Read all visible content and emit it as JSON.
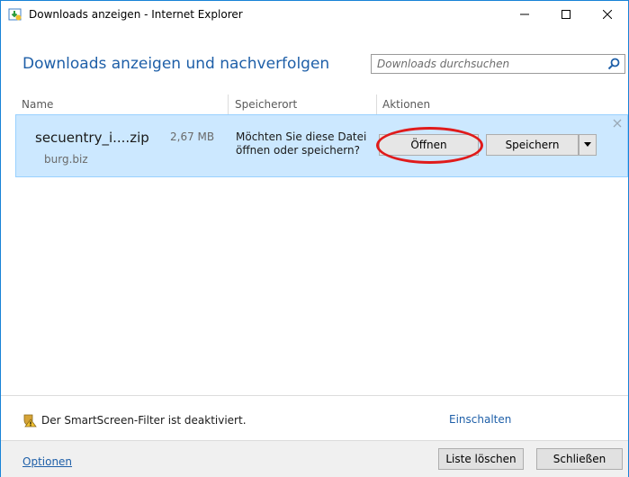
{
  "window": {
    "title": "Downloads anzeigen - Internet Explorer",
    "title_icon": "ie-downloads-icon",
    "controls": {
      "minimize": "minimize-icon",
      "maximize": "maximize-icon",
      "close": "close-icon"
    }
  },
  "header": {
    "title": "Downloads anzeigen und nachverfolgen",
    "search_placeholder": "Downloads durchsuchen",
    "search_icon": "search-icon"
  },
  "columns": {
    "name": "Name",
    "location": "Speicherort",
    "actions": "Aktionen"
  },
  "download": {
    "file_name": "secuentry_i....zip",
    "file_size": "2,67 MB",
    "host": "burg.biz",
    "prompt": "Möchten Sie diese Datei öffnen oder speichern?",
    "open_label": "Öffnen",
    "save_label": "Speichern",
    "highlight_color": "#e01b1b",
    "row_color": "#cce8ff"
  },
  "smartscreen": {
    "text": "Der SmartScreen-Filter ist deaktiviert.",
    "enable_link": "Einschalten",
    "icon": "shield-warning-icon"
  },
  "footer": {
    "options_link": "Optionen",
    "clear_list_label": "Liste löschen",
    "close_label": "Schließen"
  },
  "colors": {
    "accent": "#1e5fa8",
    "window_border": "#1883d7"
  }
}
